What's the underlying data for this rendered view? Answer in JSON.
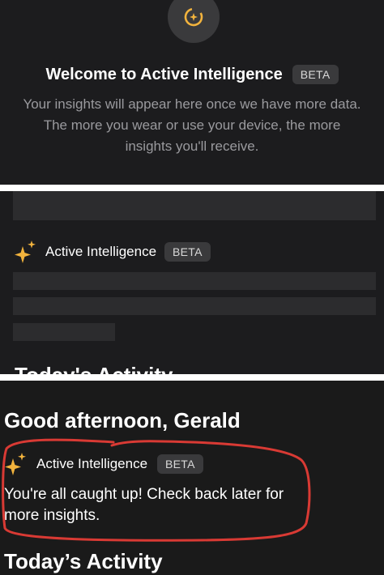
{
  "panel1": {
    "logo_icon": "active-intelligence-logo",
    "title": "Welcome to Active Intelligence",
    "badge": "BETA",
    "body": "Your insights will appear here once we have more data. The more you wear or use your device, the more insights you'll receive."
  },
  "panel2": {
    "sparkle_icon": "sparkle-icon",
    "label": "Active Intelligence",
    "badge": "BETA",
    "partial_heading": "Today's Activity"
  },
  "panel3": {
    "greeting": "Good afternoon, Gerald",
    "label": "Active Intelligence",
    "badge": "BETA",
    "message": "You're all caught up! Check back later for more insights.",
    "section_heading": "Today’s Activity"
  },
  "colors": {
    "background": "#1c1c1e",
    "accent_gold": "#f2b33d",
    "badge_bg": "#3a3a3c",
    "annotation_red": "#d93a34"
  }
}
